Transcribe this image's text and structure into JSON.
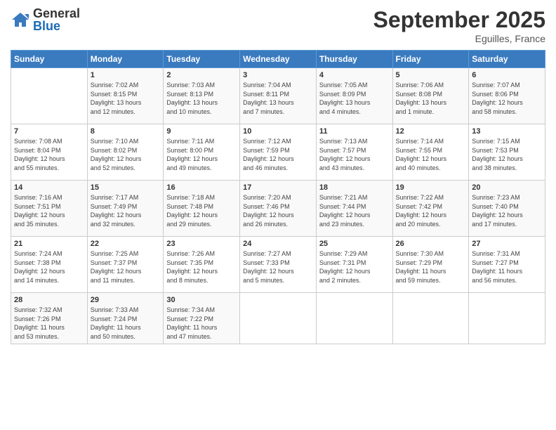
{
  "header": {
    "logo_general": "General",
    "logo_blue": "Blue",
    "month_title": "September 2025",
    "location": "Eguilles, France"
  },
  "days_of_week": [
    "Sunday",
    "Monday",
    "Tuesday",
    "Wednesday",
    "Thursday",
    "Friday",
    "Saturday"
  ],
  "weeks": [
    [
      {
        "day": "",
        "info": ""
      },
      {
        "day": "1",
        "info": "Sunrise: 7:02 AM\nSunset: 8:15 PM\nDaylight: 13 hours\nand 12 minutes."
      },
      {
        "day": "2",
        "info": "Sunrise: 7:03 AM\nSunset: 8:13 PM\nDaylight: 13 hours\nand 10 minutes."
      },
      {
        "day": "3",
        "info": "Sunrise: 7:04 AM\nSunset: 8:11 PM\nDaylight: 13 hours\nand 7 minutes."
      },
      {
        "day": "4",
        "info": "Sunrise: 7:05 AM\nSunset: 8:09 PM\nDaylight: 13 hours\nand 4 minutes."
      },
      {
        "day": "5",
        "info": "Sunrise: 7:06 AM\nSunset: 8:08 PM\nDaylight: 13 hours\nand 1 minute."
      },
      {
        "day": "6",
        "info": "Sunrise: 7:07 AM\nSunset: 8:06 PM\nDaylight: 12 hours\nand 58 minutes."
      }
    ],
    [
      {
        "day": "7",
        "info": "Sunrise: 7:08 AM\nSunset: 8:04 PM\nDaylight: 12 hours\nand 55 minutes."
      },
      {
        "day": "8",
        "info": "Sunrise: 7:10 AM\nSunset: 8:02 PM\nDaylight: 12 hours\nand 52 minutes."
      },
      {
        "day": "9",
        "info": "Sunrise: 7:11 AM\nSunset: 8:00 PM\nDaylight: 12 hours\nand 49 minutes."
      },
      {
        "day": "10",
        "info": "Sunrise: 7:12 AM\nSunset: 7:59 PM\nDaylight: 12 hours\nand 46 minutes."
      },
      {
        "day": "11",
        "info": "Sunrise: 7:13 AM\nSunset: 7:57 PM\nDaylight: 12 hours\nand 43 minutes."
      },
      {
        "day": "12",
        "info": "Sunrise: 7:14 AM\nSunset: 7:55 PM\nDaylight: 12 hours\nand 40 minutes."
      },
      {
        "day": "13",
        "info": "Sunrise: 7:15 AM\nSunset: 7:53 PM\nDaylight: 12 hours\nand 38 minutes."
      }
    ],
    [
      {
        "day": "14",
        "info": "Sunrise: 7:16 AM\nSunset: 7:51 PM\nDaylight: 12 hours\nand 35 minutes."
      },
      {
        "day": "15",
        "info": "Sunrise: 7:17 AM\nSunset: 7:49 PM\nDaylight: 12 hours\nand 32 minutes."
      },
      {
        "day": "16",
        "info": "Sunrise: 7:18 AM\nSunset: 7:48 PM\nDaylight: 12 hours\nand 29 minutes."
      },
      {
        "day": "17",
        "info": "Sunrise: 7:20 AM\nSunset: 7:46 PM\nDaylight: 12 hours\nand 26 minutes."
      },
      {
        "day": "18",
        "info": "Sunrise: 7:21 AM\nSunset: 7:44 PM\nDaylight: 12 hours\nand 23 minutes."
      },
      {
        "day": "19",
        "info": "Sunrise: 7:22 AM\nSunset: 7:42 PM\nDaylight: 12 hours\nand 20 minutes."
      },
      {
        "day": "20",
        "info": "Sunrise: 7:23 AM\nSunset: 7:40 PM\nDaylight: 12 hours\nand 17 minutes."
      }
    ],
    [
      {
        "day": "21",
        "info": "Sunrise: 7:24 AM\nSunset: 7:38 PM\nDaylight: 12 hours\nand 14 minutes."
      },
      {
        "day": "22",
        "info": "Sunrise: 7:25 AM\nSunset: 7:37 PM\nDaylight: 12 hours\nand 11 minutes."
      },
      {
        "day": "23",
        "info": "Sunrise: 7:26 AM\nSunset: 7:35 PM\nDaylight: 12 hours\nand 8 minutes."
      },
      {
        "day": "24",
        "info": "Sunrise: 7:27 AM\nSunset: 7:33 PM\nDaylight: 12 hours\nand 5 minutes."
      },
      {
        "day": "25",
        "info": "Sunrise: 7:29 AM\nSunset: 7:31 PM\nDaylight: 12 hours\nand 2 minutes."
      },
      {
        "day": "26",
        "info": "Sunrise: 7:30 AM\nSunset: 7:29 PM\nDaylight: 11 hours\nand 59 minutes."
      },
      {
        "day": "27",
        "info": "Sunrise: 7:31 AM\nSunset: 7:27 PM\nDaylight: 11 hours\nand 56 minutes."
      }
    ],
    [
      {
        "day": "28",
        "info": "Sunrise: 7:32 AM\nSunset: 7:26 PM\nDaylight: 11 hours\nand 53 minutes."
      },
      {
        "day": "29",
        "info": "Sunrise: 7:33 AM\nSunset: 7:24 PM\nDaylight: 11 hours\nand 50 minutes."
      },
      {
        "day": "30",
        "info": "Sunrise: 7:34 AM\nSunset: 7:22 PM\nDaylight: 11 hours\nand 47 minutes."
      },
      {
        "day": "",
        "info": ""
      },
      {
        "day": "",
        "info": ""
      },
      {
        "day": "",
        "info": ""
      },
      {
        "day": "",
        "info": ""
      }
    ]
  ]
}
